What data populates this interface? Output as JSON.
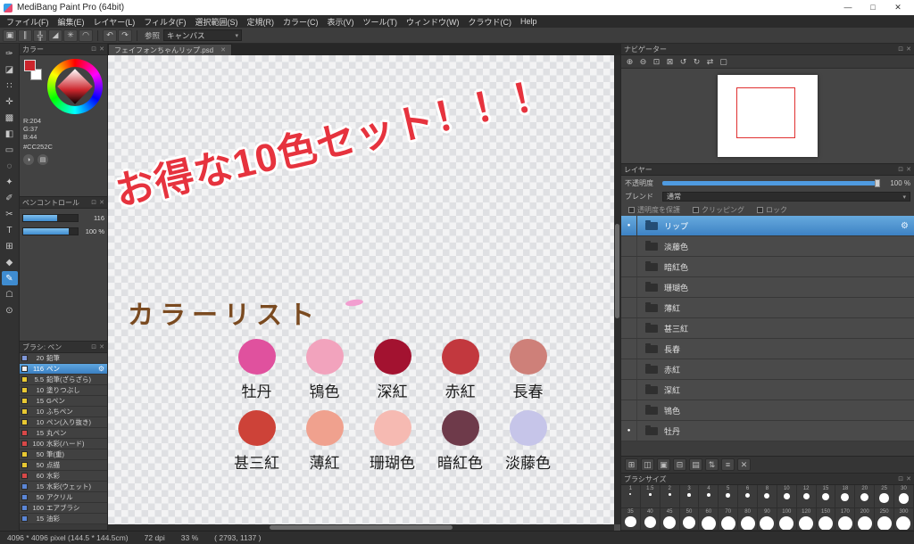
{
  "titlebar": {
    "title": "MediBang Paint Pro (64bit)",
    "minimize": "—",
    "maximize": "□",
    "close": "✕"
  },
  "icons": {
    "gear": "⚙",
    "dot": "●",
    "caret": "▾",
    "close": "✕",
    "float": "⊡"
  },
  "menubar": {
    "items": [
      "ファイル(F)",
      "編集(E)",
      "レイヤー(L)",
      "フィルタ(F)",
      "選択範囲(S)",
      "定規(R)",
      "カラー(C)",
      "表示(V)",
      "ツール(T)",
      "ウィンドウ(W)",
      "クラウド(C)",
      "Help"
    ]
  },
  "toolbar": {
    "icons": [
      {
        "name": "snap-off-icon",
        "glyph": "▣"
      },
      {
        "name": "snap-parallel-icon",
        "glyph": "∥"
      },
      {
        "name": "snap-cross-icon",
        "glyph": "╬"
      },
      {
        "name": "snap-vanishing-point-icon",
        "glyph": "◢"
      },
      {
        "name": "snap-radial-icon",
        "glyph": "✳"
      },
      {
        "name": "snap-curve-icon",
        "glyph": "◠"
      }
    ],
    "undo": "↶",
    "redo": "↷",
    "reference_label": "参照",
    "reference_value": "キャンバス"
  },
  "tools": [
    {
      "name": "brush-tool",
      "glyph": "✑"
    },
    {
      "name": "eraser-tool",
      "glyph": "◪"
    },
    {
      "name": "dot-tool",
      "glyph": "∷"
    },
    {
      "name": "move-tool",
      "glyph": "✛"
    },
    {
      "name": "fill-tool",
      "glyph": "▩"
    },
    {
      "name": "gradient-tool",
      "glyph": "◧"
    },
    {
      "name": "select-tool",
      "glyph": "▭"
    },
    {
      "name": "lasso-tool",
      "glyph": "◌"
    },
    {
      "name": "magic-wand-tool",
      "glyph": "✦"
    },
    {
      "name": "select-pen-tool",
      "glyph": "✐"
    },
    {
      "name": "select-eraser-tool",
      "glyph": "✂"
    },
    {
      "name": "text-tool",
      "glyph": "T"
    },
    {
      "name": "panel-divide-tool",
      "glyph": "⊞"
    },
    {
      "name": "eyedropper-tool",
      "glyph": "◆"
    },
    {
      "name": "pencil-tool",
      "glyph": "✎",
      "selected": true
    },
    {
      "name": "hand-tool",
      "glyph": "☖"
    },
    {
      "name": "zoom-tool",
      "glyph": "⊙"
    }
  ],
  "color_panel": {
    "title": "カラー",
    "r": "R:204",
    "g": "G:37",
    "b": "B:44",
    "hex": "#CC252C",
    "fg_color": "#CC252C",
    "bg_color": "#FFFFFF",
    "buttons": [
      {
        "name": "color-wheel-mode-icon",
        "glyph": "◑"
      },
      {
        "name": "color-slider-mode-icon",
        "glyph": "▤"
      }
    ]
  },
  "pen_control": {
    "title": "ペンコントロール",
    "rows": [
      {
        "value": "116",
        "fill": 62
      },
      {
        "value": "100 %",
        "fill": 83
      }
    ]
  },
  "brush_panel": {
    "title": "ブラシ: ペン",
    "brushes": [
      {
        "size": "20",
        "name": "鉛筆",
        "chip": "#8098d8"
      },
      {
        "size": "116",
        "name": "ペン",
        "chip": "#f0f0f0",
        "selected": true
      },
      {
        "size": "5.5",
        "name": "鉛筆(ざらざら)",
        "chip": "#e8c832"
      },
      {
        "size": "10",
        "name": "塗りつぶし",
        "chip": "#e8c832"
      },
      {
        "size": "15",
        "name": "Gペン",
        "chip": "#e8c832"
      },
      {
        "size": "10",
        "name": "ふちペン",
        "chip": "#e8c832"
      },
      {
        "size": "10",
        "name": "ペン(入り抜き)",
        "chip": "#e8c832"
      },
      {
        "size": "15",
        "name": "丸ペン",
        "chip": "#d84848"
      },
      {
        "size": "100",
        "name": "水彩(ハード)",
        "chip": "#d84848"
      },
      {
        "size": "50",
        "name": "筆(重)",
        "chip": "#e8c832"
      },
      {
        "size": "50",
        "name": "点描",
        "chip": "#e8c832"
      },
      {
        "size": "60",
        "name": "水彩",
        "chip": "#d84848"
      },
      {
        "size": "15",
        "name": "水彩(ウェット)",
        "chip": "#5b86d5"
      },
      {
        "size": "50",
        "name": "アクリル",
        "chip": "#5b86d5"
      },
      {
        "size": "100",
        "name": "エアブラシ",
        "chip": "#5b86d5"
      },
      {
        "size": "15",
        "name": "油彩",
        "chip": "#5b86d5"
      }
    ]
  },
  "document": {
    "tab": "フェイフォンちゃんリップ.psd",
    "headline": "お得な10色セット！！！",
    "list_title": "カラーリスト",
    "swatches": [
      [
        {
          "name": "牡丹",
          "color": "#e0519e"
        },
        {
          "name": "鴇色",
          "color": "#f2a3bd"
        },
        {
          "name": "深紅",
          "color": "#a31230"
        },
        {
          "name": "赤紅",
          "color": "#c2383e"
        },
        {
          "name": "長春",
          "color": "#ce8079"
        }
      ],
      [
        {
          "name": "甚三紅",
          "color": "#cd4238"
        },
        {
          "name": "薄紅",
          "color": "#f0a18e"
        },
        {
          "name": "珊瑚色",
          "color": "#f6bab2"
        },
        {
          "name": "暗紅色",
          "color": "#6e3a4a"
        },
        {
          "name": "淡藤色",
          "color": "#c6c5e9"
        }
      ]
    ]
  },
  "navigator": {
    "title": "ナビゲーター",
    "icons": [
      {
        "name": "zoom-in-icon",
        "glyph": "⊕"
      },
      {
        "name": "zoom-out-icon",
        "glyph": "⊖"
      },
      {
        "name": "zoom-fit-icon",
        "glyph": "⊡"
      },
      {
        "name": "zoom-actual-icon",
        "glyph": "⊠"
      },
      {
        "name": "rotate-left-icon",
        "glyph": "↺"
      },
      {
        "name": "rotate-right-icon",
        "glyph": "↻"
      },
      {
        "name": "flip-icon",
        "glyph": "⇄"
      },
      {
        "name": "reset-view-icon",
        "glyph": "▢"
      }
    ]
  },
  "layers": {
    "title": "レイヤー",
    "opacity_label": "不透明度",
    "opacity_value": "100 %",
    "blend_label": "ブレンド",
    "blend_value": "通常",
    "checkboxes": [
      "透明度を保護",
      "クリッピング",
      "ロック"
    ],
    "items": [
      {
        "name": "リップ",
        "selected": true,
        "dot": true
      },
      {
        "name": "淡藤色"
      },
      {
        "name": "暗紅色"
      },
      {
        "name": "珊瑚色"
      },
      {
        "name": "薄紅"
      },
      {
        "name": "甚三紅"
      },
      {
        "name": "長春"
      },
      {
        "name": "赤紅"
      },
      {
        "name": "深紅"
      },
      {
        "name": "鴇色"
      },
      {
        "name": "牡丹",
        "dot": true
      }
    ],
    "tool_icons": [
      {
        "name": "add-layer-icon",
        "glyph": "⊞"
      },
      {
        "name": "duplicate-layer-icon",
        "glyph": "◫"
      },
      {
        "name": "import-image-icon",
        "glyph": "▣"
      },
      {
        "name": "add-folder-icon",
        "glyph": "⊟"
      },
      {
        "name": "folder-icon",
        "glyph": "▤"
      },
      {
        "name": "reorder-layer-icon",
        "glyph": "⇅"
      },
      {
        "name": "merge-layer-icon",
        "glyph": "≡"
      },
      {
        "name": "delete-layer-icon",
        "glyph": "✕"
      }
    ]
  },
  "brush_sizes": {
    "title": "ブラシサイズ",
    "row1": [
      "1",
      "1.5",
      "2",
      "3",
      "4",
      "5",
      "6",
      "8",
      "10",
      "12",
      "15",
      "18",
      "20",
      "25",
      "30"
    ],
    "row2": [
      "35",
      "40",
      "45",
      "50",
      "60",
      "70",
      "80",
      "90",
      "100",
      "120",
      "150",
      "170",
      "200",
      "250",
      "300"
    ]
  },
  "statusbar": {
    "size": "4096 * 4096 pixel  (144.5 * 144.5cm)",
    "dpi": "72 dpi",
    "zoom": "33 %",
    "coords": "( 2793, 1137 )"
  }
}
